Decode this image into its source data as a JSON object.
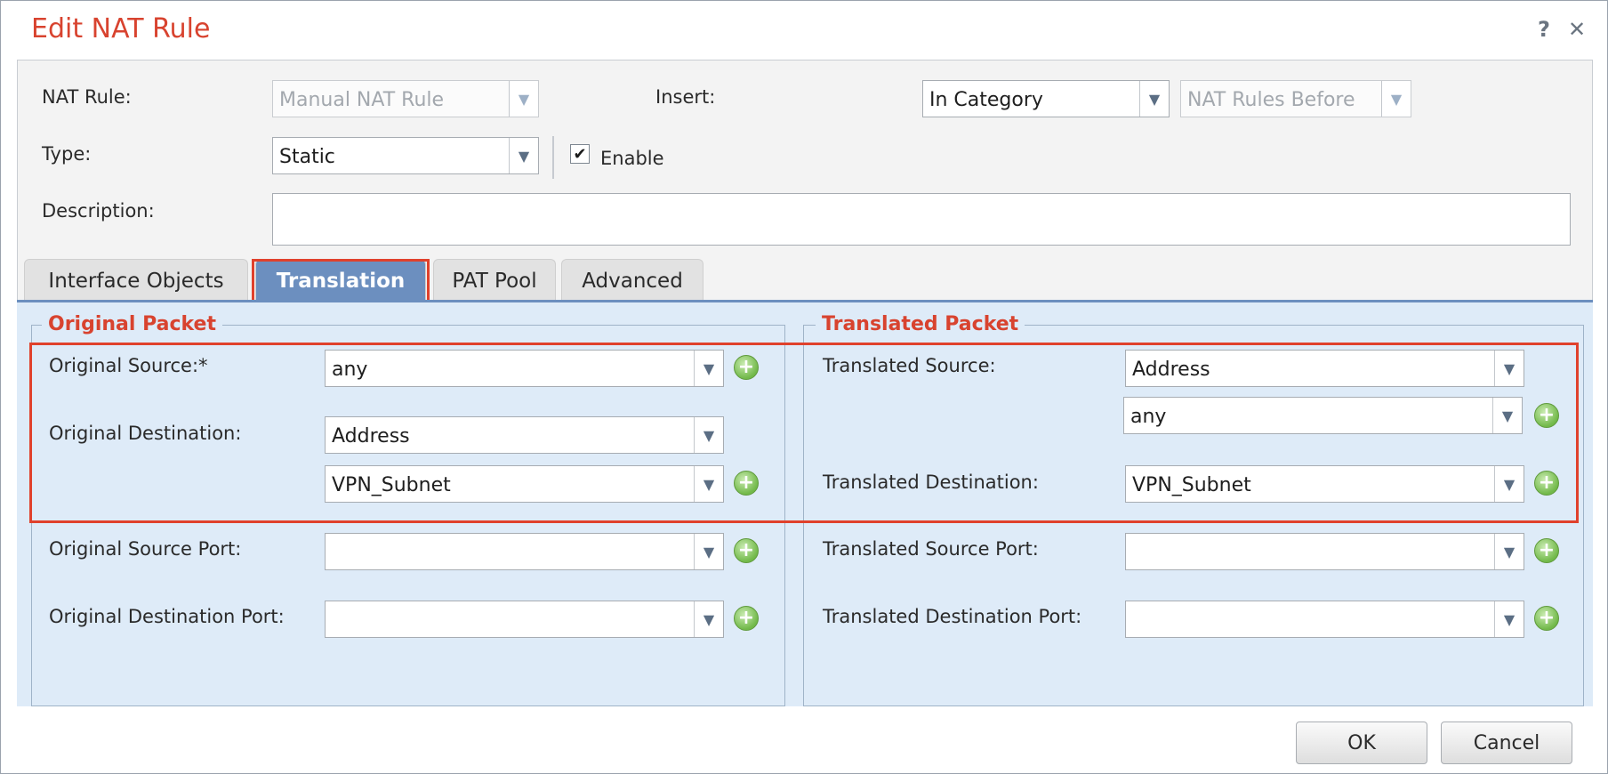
{
  "dialog": {
    "title": "Edit NAT Rule",
    "help_label": "?",
    "close_label": "✕"
  },
  "form": {
    "nat_rule_label": "NAT Rule:",
    "nat_rule_value": "Manual NAT Rule",
    "insert_label": "Insert:",
    "insert_value": "In Category",
    "insert_position_value": "NAT Rules Before",
    "type_label": "Type:",
    "type_value": "Static",
    "enable_label": "Enable",
    "enable_checked": "✔",
    "description_label": "Description:",
    "description_value": ""
  },
  "tabs": [
    {
      "label": "Interface Objects"
    },
    {
      "label": "Translation"
    },
    {
      "label": "PAT Pool"
    },
    {
      "label": "Advanced"
    }
  ],
  "original_packet": {
    "legend": "Original Packet",
    "source_label": "Original Source:*",
    "source_value": "any",
    "destination_label": "Original Destination:",
    "destination_type_value": "Address",
    "destination_value": "VPN_Subnet",
    "source_port_label": "Original Source Port:",
    "source_port_value": "",
    "destination_port_label": "Original Destination Port:",
    "destination_port_value": ""
  },
  "translated_packet": {
    "legend": "Translated Packet",
    "source_label": "Translated Source:",
    "source_type_value": "Address",
    "source_value": "any",
    "destination_label": "Translated Destination:",
    "destination_value": "VPN_Subnet",
    "source_port_label": "Translated Source Port:",
    "source_port_value": "",
    "destination_port_label": "Translated Destination Port:",
    "destination_port_value": ""
  },
  "footer": {
    "ok_label": "OK",
    "cancel_label": "Cancel"
  },
  "icons": {
    "dropdown": "chevron-down-icon",
    "add": "plus-circle-icon"
  },
  "colors": {
    "title": "#d8432f",
    "active_tab": "#6c8fbf",
    "highlight": "#e0412c",
    "panel_bg": "#deebf8",
    "add_icon": "#72b94a"
  }
}
